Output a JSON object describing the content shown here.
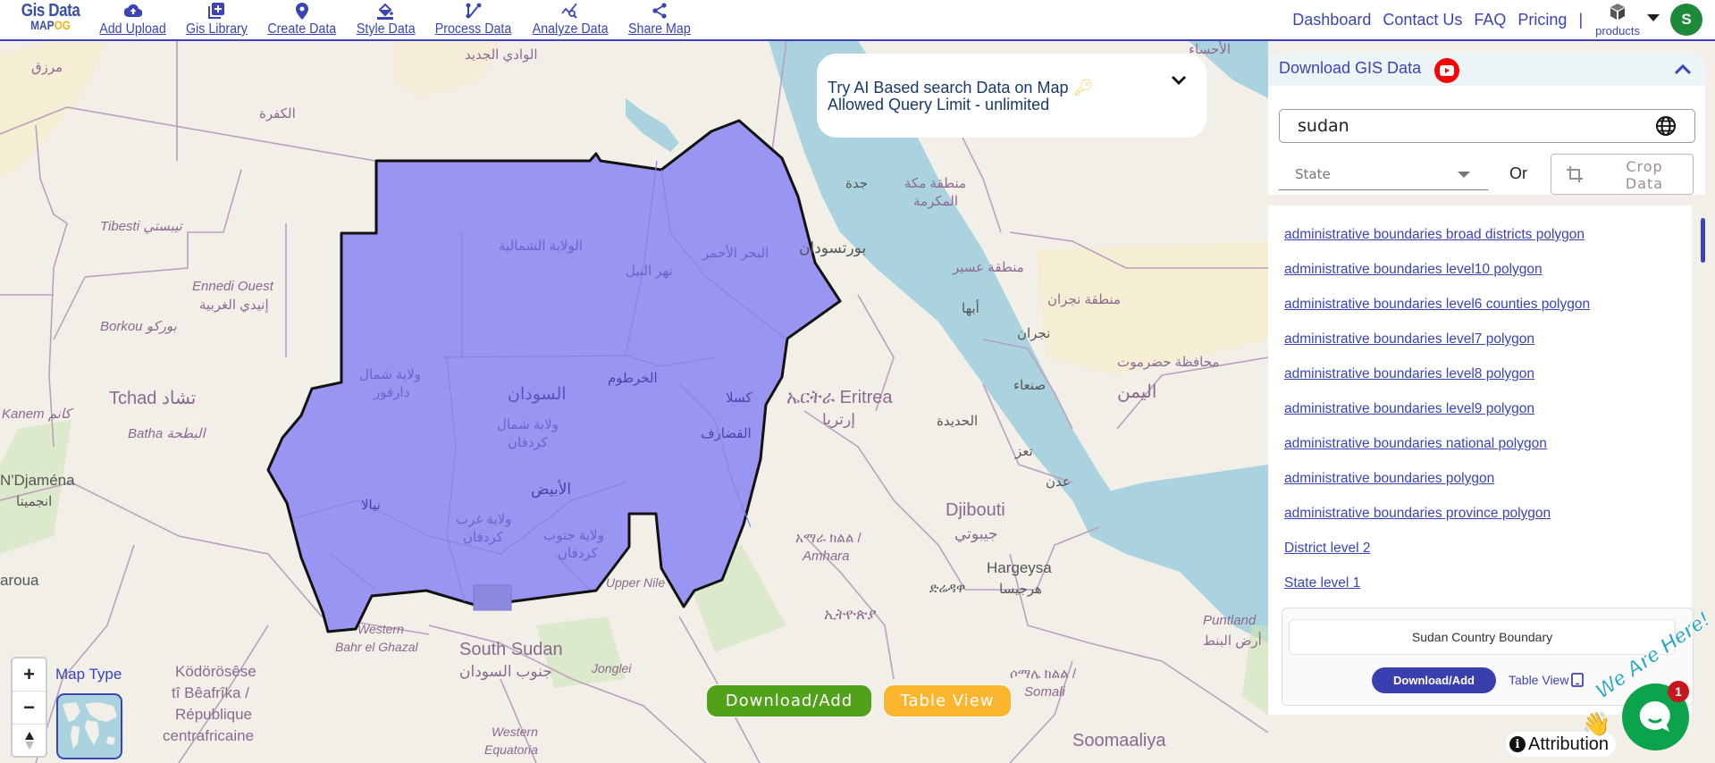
{
  "app": {
    "logo_line1": "Gis Data",
    "logo_line2_a": "MAP",
    "logo_line2_b": "OG"
  },
  "nav": {
    "items": [
      {
        "label": "Add Upload",
        "icon": "cloud-upload-icon"
      },
      {
        "label": "Gis Library",
        "icon": "library-add-icon"
      },
      {
        "label": "Create Data",
        "icon": "map-pin-icon"
      },
      {
        "label": "Style Data",
        "icon": "paint-bucket-icon"
      },
      {
        "label": "Process Data",
        "icon": "process-icon"
      },
      {
        "label": "Analyze Data",
        "icon": "analyze-chart-icon"
      },
      {
        "label": "Share Map",
        "icon": "share-icon"
      }
    ],
    "right": {
      "dashboard": "Dashboard",
      "contact": "Contact Us",
      "faq": "FAQ",
      "pricing": "Pricing",
      "separator": "|",
      "products": "products",
      "avatar_initial": "S"
    }
  },
  "ai_search": {
    "line1": "Try AI Based search Data on Map",
    "line2": "Allowed Query Limit - unlimited"
  },
  "panel": {
    "title": "Download GIS Data",
    "search_value": "sudan",
    "state_placeholder": "State",
    "or_label": "Or",
    "crop_label": "Crop Data",
    "links": [
      "administrative boundaries broad districts polygon",
      "administrative boundaries level10 polygon",
      "administrative boundaries level6 counties polygon",
      "administrative boundaries level7 polygon",
      "administrative boundaries level8 polygon",
      "administrative boundaries level9 polygon",
      "administrative boundaries national polygon",
      "administrative boundaries polygon",
      "administrative boundaries province polygon",
      "District level 2",
      "State level 1"
    ],
    "result": {
      "name": "Sudan Country Boundary",
      "download_label": "Download/Add",
      "table_view_label": "Table View"
    }
  },
  "map": {
    "bottom_buttons": {
      "download": "Download/Add",
      "table_view": "Table View"
    },
    "zoom_in": "+",
    "zoom_out": "−",
    "map_type_label": "Map Type",
    "attribution": "Attribution",
    "chat_badge": "1",
    "chat_banner": "We Are Here!",
    "colors": {
      "sudan_fill": "#9a94f2",
      "water": "#aad3df",
      "accent": "#3a44b5"
    },
    "labels": [
      {
        "text": "مرزق"
      },
      {
        "text": "الوادي الجديد"
      },
      {
        "text": "الكفرة"
      },
      {
        "text": "Tibesti تيبستي"
      },
      {
        "text": "Ennedi Ouest"
      },
      {
        "text": "إنيدي الغربية"
      },
      {
        "text": "Borkou بوركو"
      },
      {
        "text": "Tchad تشاد"
      },
      {
        "text": "Kanem كانم"
      },
      {
        "text": "Batha البطحة"
      },
      {
        "text": "N'Djaména"
      },
      {
        "text": "انجمينا"
      },
      {
        "text": "aroua"
      },
      {
        "text": "Ködörösêse"
      },
      {
        "text": "tî Bêafrîka /"
      },
      {
        "text": "République"
      },
      {
        "text": "centrafricaine"
      },
      {
        "text": "Western"
      },
      {
        "text": "Bahr el Ghazal"
      },
      {
        "text": "South Sudan"
      },
      {
        "text": "جنوب السودان"
      },
      {
        "text": "Jonglei"
      },
      {
        "text": "Upper Nile"
      },
      {
        "text": "Western"
      },
      {
        "text": "Equatoria"
      },
      {
        "text": "الولاية الشمالية"
      },
      {
        "text": "نهر النيل"
      },
      {
        "text": "البحر الأحمر"
      },
      {
        "text": "ولاية شمال"
      },
      {
        "text": "دارفور"
      },
      {
        "text": "السودان"
      },
      {
        "text": "الخرطوم"
      },
      {
        "text": "كسلا"
      },
      {
        "text": "ولاية شمال"
      },
      {
        "text": "كردفان"
      },
      {
        "text": "القضارف"
      },
      {
        "text": "الأبيض"
      },
      {
        "text": "نيالا"
      },
      {
        "text": "ولاية غرب"
      },
      {
        "text": "كردفان"
      },
      {
        "text": "ولاية جنوب"
      },
      {
        "text": "كردفان"
      },
      {
        "text": "بورتسودان"
      },
      {
        "text": "جدة"
      },
      {
        "text": "منطقة مكة"
      },
      {
        "text": "المكرمة"
      },
      {
        "text": "منطقة عسير"
      },
      {
        "text": "أبها"
      },
      {
        "text": "منطقة نجران"
      },
      {
        "text": "نجران"
      },
      {
        "text": "محافظة حضرموت"
      },
      {
        "text": "اليمن"
      },
      {
        "text": "صنعاء"
      },
      {
        "text": "الحديدة"
      },
      {
        "text": "تعز"
      },
      {
        "text": "عدن"
      },
      {
        "text": "ኤርትራ Eritrea"
      },
      {
        "text": "إرتريا"
      },
      {
        "text": "Djibouti"
      },
      {
        "text": "جيبوتي"
      },
      {
        "text": "Hargeysa"
      },
      {
        "text": "هرجيسا"
      },
      {
        "text": "ድሬዳዋ"
      },
      {
        "text": "አማራ ክልል /"
      },
      {
        "text": "Amhara"
      },
      {
        "text": "ኢትዮጵያ"
      },
      {
        "text": "ሶማሌ ክልል /"
      },
      {
        "text": "Somali"
      },
      {
        "text": "Puntland"
      },
      {
        "text": "أرض البنط"
      },
      {
        "text": "Soomaaliya"
      },
      {
        "text": "الأحساء"
      }
    ]
  }
}
